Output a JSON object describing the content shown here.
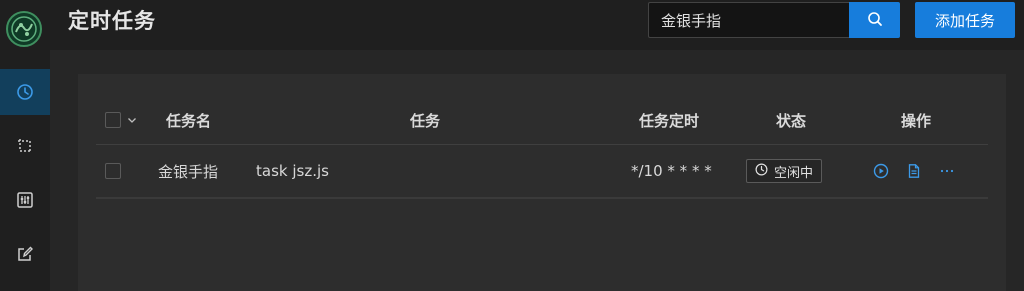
{
  "header": {
    "title": "定时任务",
    "add_button_label": "添加任务"
  },
  "search": {
    "value": "金银手指",
    "icon": "search-icon"
  },
  "sidebar": {
    "items": [
      {
        "icon": "clock-icon",
        "active": true
      },
      {
        "icon": "crop-icon",
        "active": false
      },
      {
        "icon": "sliders-icon",
        "active": false
      },
      {
        "icon": "edit-icon",
        "active": false
      }
    ]
  },
  "table": {
    "columns": [
      "任务名",
      "任务",
      "任务定时",
      "状态",
      "操作"
    ],
    "rows": [
      {
        "name": "金银手指",
        "command": "task jsz.js",
        "schedule": "*/10 * * * *",
        "status": "空闲中",
        "actions": [
          "run-icon",
          "log-icon",
          "more-icon"
        ]
      }
    ]
  },
  "colors": {
    "accent": "#177ddc",
    "background": "#1f1f1f",
    "card": "#2d2d2d"
  }
}
